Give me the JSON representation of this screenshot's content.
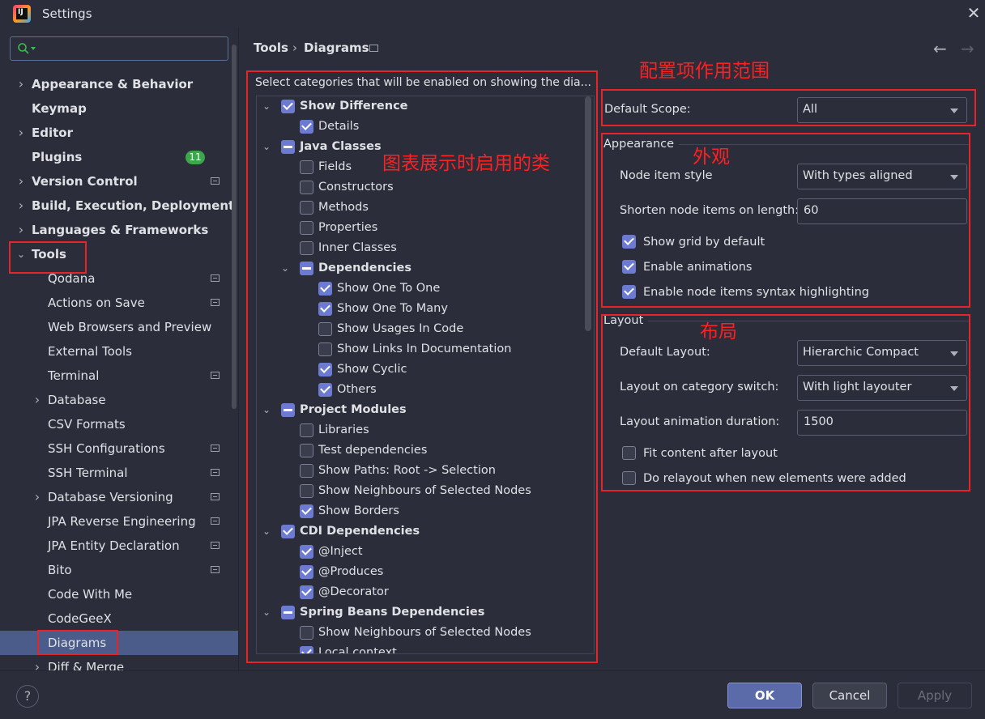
{
  "window": {
    "title": "Settings",
    "app_icon_letters": "IJ"
  },
  "search": {
    "placeholder": ""
  },
  "sidebar": {
    "items": [
      {
        "label": "Appearance & Behavior",
        "level": 0,
        "expandable": true,
        "expanded": false,
        "bold": true
      },
      {
        "label": "Keymap",
        "level": 0,
        "bold": true
      },
      {
        "label": "Editor",
        "level": 0,
        "expandable": true,
        "expanded": false,
        "bold": true
      },
      {
        "label": "Plugins",
        "level": 0,
        "bold": true,
        "badge": "11"
      },
      {
        "label": "Version Control",
        "level": 0,
        "expandable": true,
        "expanded": false,
        "bold": true,
        "marker": true
      },
      {
        "label": "Build, Execution, Deployment",
        "level": 0,
        "expandable": true,
        "expanded": false,
        "bold": true
      },
      {
        "label": "Languages & Frameworks",
        "level": 0,
        "expandable": true,
        "expanded": false,
        "bold": true
      },
      {
        "label": "Tools",
        "level": 0,
        "expandable": true,
        "expanded": true,
        "bold": true
      },
      {
        "label": "Qodana",
        "level": 1,
        "marker": true
      },
      {
        "label": "Actions on Save",
        "level": 1,
        "marker": true
      },
      {
        "label": "Web Browsers and Preview",
        "level": 1
      },
      {
        "label": "External Tools",
        "level": 1
      },
      {
        "label": "Terminal",
        "level": 1,
        "marker": true
      },
      {
        "label": "Database",
        "level": 1,
        "expandable": true,
        "expanded": false
      },
      {
        "label": "CSV Formats",
        "level": 1
      },
      {
        "label": "SSH Configurations",
        "level": 1,
        "marker": true
      },
      {
        "label": "SSH Terminal",
        "level": 1,
        "marker": true
      },
      {
        "label": "Database Versioning",
        "level": 1,
        "expandable": true,
        "expanded": false,
        "marker": true
      },
      {
        "label": "JPA Reverse Engineering",
        "level": 1,
        "marker": true
      },
      {
        "label": "JPA Entity Declaration",
        "level": 1,
        "marker": true
      },
      {
        "label": "Bito",
        "level": 1,
        "marker": true
      },
      {
        "label": "Code With Me",
        "level": 1
      },
      {
        "label": "CodeGeeX",
        "level": 1
      },
      {
        "label": "Diagrams",
        "level": 1,
        "selected": true
      },
      {
        "label": "Diff & Merge",
        "level": 1,
        "expandable": true,
        "expanded": false
      }
    ]
  },
  "breadcrumb": {
    "parent": "Tools",
    "separator": "›",
    "current": "Diagrams"
  },
  "nav": {
    "back": "←",
    "forward": "→"
  },
  "categories": {
    "description": "Select categories that will be enabled on showing the dia...",
    "items": [
      {
        "label": "Show Difference",
        "level": 0,
        "expandable": true,
        "bold": true,
        "state": "checked"
      },
      {
        "label": "Details",
        "level": 1,
        "state": "checked"
      },
      {
        "label": "Java Classes",
        "level": 0,
        "expandable": true,
        "bold": true,
        "state": "mixed"
      },
      {
        "label": "Fields",
        "level": 1,
        "state": "empty"
      },
      {
        "label": "Constructors",
        "level": 1,
        "state": "empty"
      },
      {
        "label": "Methods",
        "level": 1,
        "state": "empty"
      },
      {
        "label": "Properties",
        "level": 1,
        "state": "empty"
      },
      {
        "label": "Inner Classes",
        "level": 1,
        "state": "empty"
      },
      {
        "label": "Dependencies",
        "level": 1,
        "expandable": true,
        "bold": true,
        "state": "mixed"
      },
      {
        "label": "Show One To One",
        "level": 2,
        "state": "checked"
      },
      {
        "label": "Show One To Many",
        "level": 2,
        "state": "checked"
      },
      {
        "label": "Show Usages In Code",
        "level": 2,
        "state": "empty"
      },
      {
        "label": "Show Links In Documentation",
        "level": 2,
        "state": "empty"
      },
      {
        "label": "Show Cyclic",
        "level": 2,
        "state": "checked"
      },
      {
        "label": "Others",
        "level": 2,
        "state": "checked"
      },
      {
        "label": "Project Modules",
        "level": 0,
        "expandable": true,
        "bold": true,
        "state": "mixed"
      },
      {
        "label": "Libraries",
        "level": 1,
        "state": "empty"
      },
      {
        "label": "Test dependencies",
        "level": 1,
        "state": "empty"
      },
      {
        "label": "Show Paths: Root -> Selection",
        "level": 1,
        "state": "empty"
      },
      {
        "label": "Show Neighbours of Selected Nodes",
        "level": 1,
        "state": "empty"
      },
      {
        "label": "Show Borders",
        "level": 1,
        "state": "checked"
      },
      {
        "label": "CDI Dependencies",
        "level": 0,
        "expandable": true,
        "bold": true,
        "state": "checked"
      },
      {
        "label": "@Inject",
        "level": 1,
        "state": "checked"
      },
      {
        "label": "@Produces",
        "level": 1,
        "state": "checked"
      },
      {
        "label": "@Decorator",
        "level": 1,
        "state": "checked"
      },
      {
        "label": "Spring Beans Dependencies",
        "level": 0,
        "expandable": true,
        "bold": true,
        "state": "mixed"
      },
      {
        "label": "Show Neighbours of Selected Nodes",
        "level": 1,
        "state": "empty"
      },
      {
        "label": "Local context",
        "level": 1,
        "state": "checked"
      }
    ]
  },
  "scope": {
    "label": "Default Scope:",
    "value": "All"
  },
  "appearance": {
    "title": "Appearance",
    "node_style_label": "Node item style",
    "node_style_value": "With types aligned",
    "shorten_label": "Shorten node items on length:",
    "shorten_value": "60",
    "checks": [
      {
        "label": "Show grid by default",
        "checked": true
      },
      {
        "label": "Enable animations",
        "checked": true
      },
      {
        "label": "Enable node items syntax highlighting",
        "checked": true
      }
    ]
  },
  "layout": {
    "title": "Layout",
    "default_layout_label": "Default Layout:",
    "default_layout_value": "Hierarchic Compact",
    "switch_label": "Layout on category switch:",
    "switch_value": "With light layouter",
    "duration_label": "Layout animation duration:",
    "duration_value": "1500",
    "checks": [
      {
        "label": "Fit content after layout",
        "checked": false
      },
      {
        "label": "Do relayout when new elements were added",
        "checked": false
      }
    ]
  },
  "annotations": {
    "scope": "配置项作用范围",
    "categories": "图表展示时启用的类",
    "appearance": "外观",
    "layout": "布局"
  },
  "buttons": {
    "ok": "OK",
    "cancel": "Cancel",
    "apply": "Apply",
    "help": "?"
  },
  "colors": {
    "accent": "#6c7bd1",
    "selection": "#4b5b8a",
    "annotation": "#e5252a",
    "badge": "#3ba64b"
  }
}
